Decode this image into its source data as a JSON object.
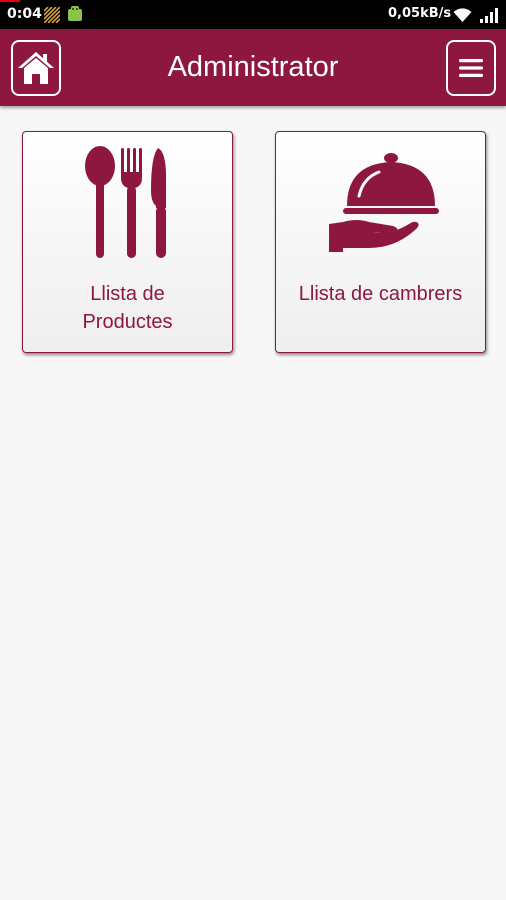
{
  "status_bar": {
    "time": "0:04",
    "network_speed": "0,05kB/s"
  },
  "app_bar": {
    "title": "Administrator",
    "home_icon": "home-icon",
    "menu_icon": "hamburger-menu-icon"
  },
  "tiles": [
    {
      "label": "Llista de\nProductes",
      "icon": "cutlery-icon"
    },
    {
      "label": "Llista de cambrers",
      "icon": "serving-cloche-icon"
    }
  ],
  "colors": {
    "brand": "#8e1740",
    "background": "#f7f7f7"
  }
}
